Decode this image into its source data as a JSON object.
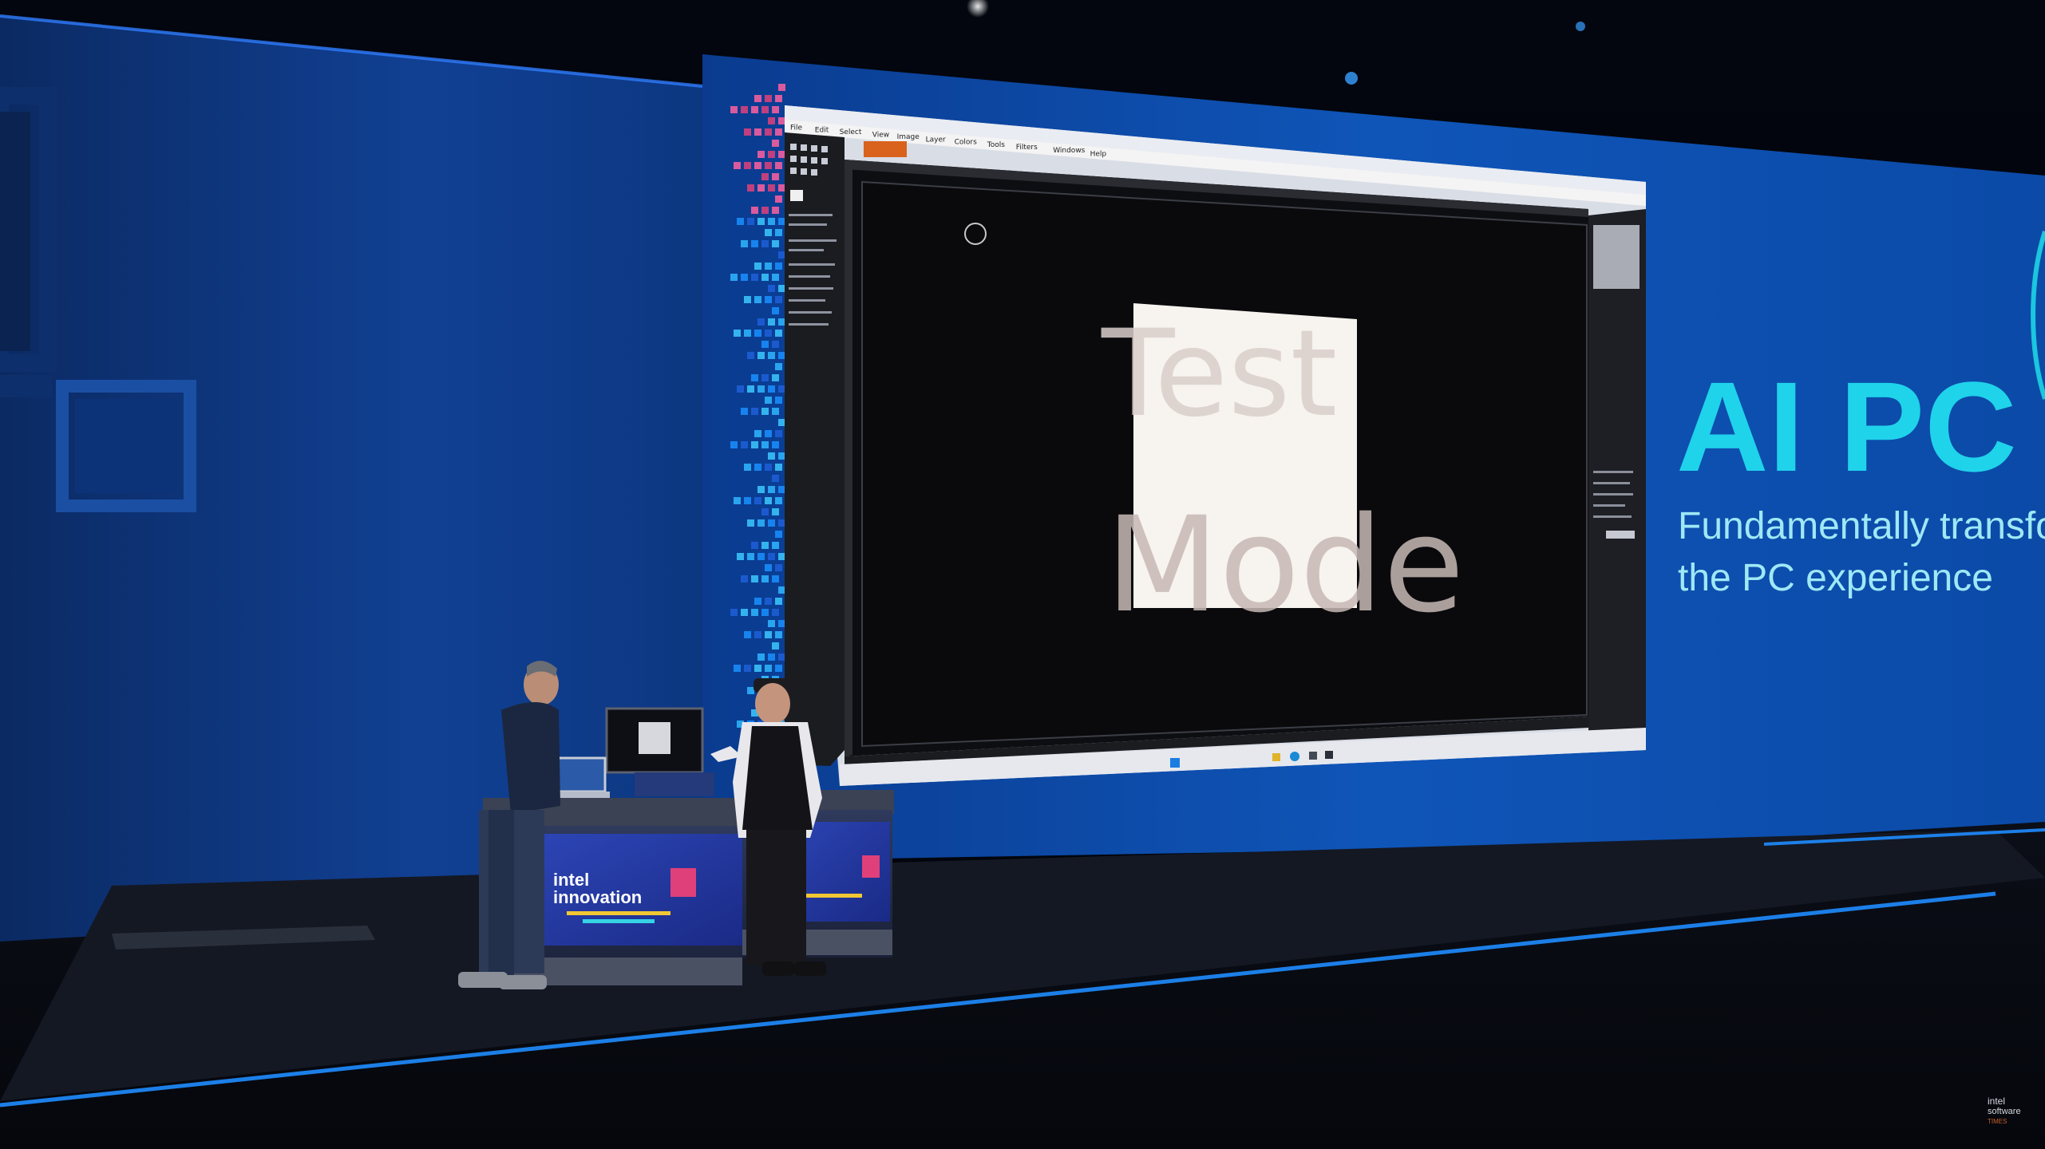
{
  "slide": {
    "headline": "AI PC",
    "subtitle_lines": [
      "Fundamentally transform",
      "the PC experience"
    ]
  },
  "app": {
    "menu_items": [
      "File",
      "Edit",
      "Select",
      "View",
      "Image",
      "Layer",
      "Colors",
      "Tools",
      "Filters",
      "Windows",
      "Help"
    ],
    "canvas_text_line1": "Test",
    "canvas_text_line2": "Mode"
  },
  "booth": {
    "brand_line1": "intel",
    "brand_line2": "innovation"
  },
  "watermark": {
    "line1": "intel",
    "line2": "software",
    "line3": "TIMES"
  },
  "colors": {
    "slide_accent": "#1fd3ea",
    "stage_edge": "#1f8cff",
    "backdrop": "#0d3f93"
  }
}
